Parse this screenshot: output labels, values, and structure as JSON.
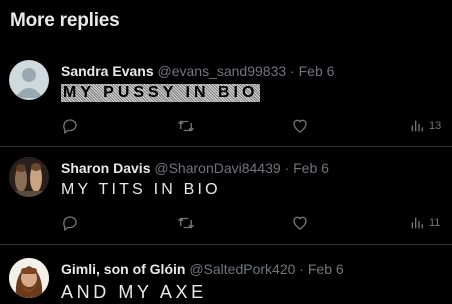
{
  "section": {
    "title": "More replies"
  },
  "replies": [
    {
      "name": "Sandra Evans",
      "handle": "@evans_sand99833",
      "separator": "·",
      "date": "Feb 6",
      "text": "MY PUSSY IN BIO",
      "views": "13"
    },
    {
      "name": "Sharon Davis",
      "handle": "@SharonDavi84439",
      "separator": "·",
      "date": "Feb 6",
      "text": "MY TITS IN BIO",
      "views": "11"
    },
    {
      "name": "Gimli, son of Glóin",
      "handle": "@SaltedPork420",
      "separator": "·",
      "date": "Feb 6",
      "text": "AND MY AXE"
    }
  ]
}
